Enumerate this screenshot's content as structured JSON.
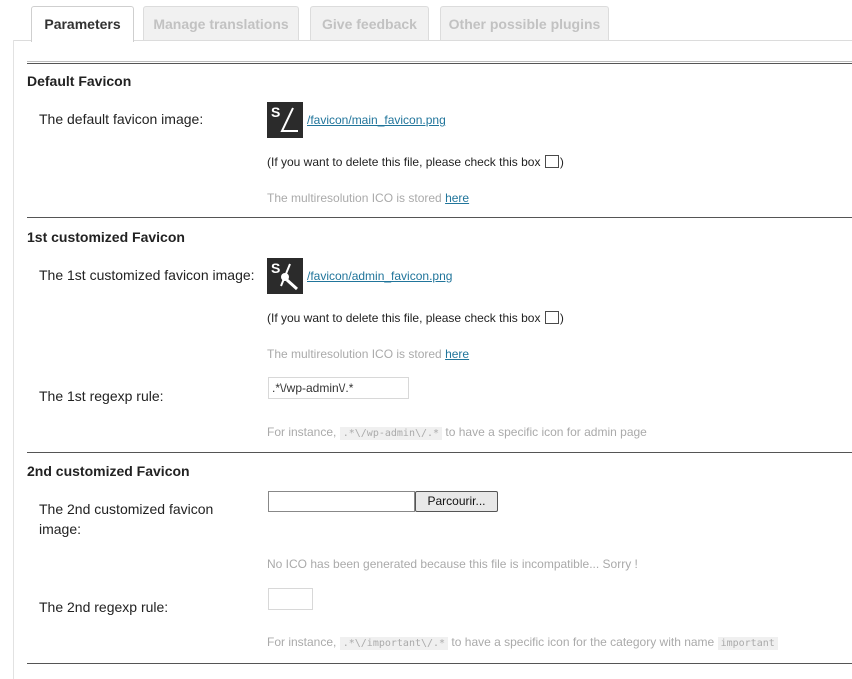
{
  "tabs": [
    {
      "label": "Parameters",
      "active": true
    },
    {
      "label": "Manage translations",
      "active": false
    },
    {
      "label": "Give feedback",
      "active": false
    },
    {
      "label": "Other possible plugins",
      "active": false
    }
  ],
  "default_section": {
    "title": "Default Favicon",
    "image_label": "The default favicon image:",
    "icon": "sl-logo-icon",
    "icon_text": "S",
    "file_link": "/favicon/main_favicon.png",
    "delete_note": "(If you want to delete this file, please check this box",
    "delete_close": ")",
    "ico_text": "The multiresolution ICO is stored",
    "ico_link": "here"
  },
  "custom1_section": {
    "title": "1st customized Favicon",
    "image_label": "The 1st customized favicon image:",
    "icon": "wrench-logo-icon",
    "icon_text": "S",
    "file_link": "/favicon/admin_favicon.png",
    "delete_note": "(If you want to delete this file, please check this box",
    "delete_close": ")",
    "ico_text": "The multiresolution ICO is stored",
    "ico_link": "here",
    "regexp_label": "The 1st regexp rule:",
    "regexp_value": ".*\\/wp-admin\\/.*",
    "instance_prefix": "For instance,",
    "instance_code": ".*\\/wp-admin\\/.*",
    "instance_suffix": "to have a specific icon for admin page"
  },
  "custom2_section": {
    "title": "2nd customized Favicon",
    "image_label": "The 2nd customized favicon image:",
    "browse_label": "Parcourir...",
    "incompatible_note": "No ICO has been generated because this file is incompatible... Sorry !",
    "regexp_label": "The 2nd regexp rule:",
    "regexp_value": "",
    "instance_prefix": "For instance,",
    "instance_code": ".*\\/important\\/.*",
    "instance_middle": "to have a specific icon for the category with name",
    "instance_code2": "important"
  }
}
